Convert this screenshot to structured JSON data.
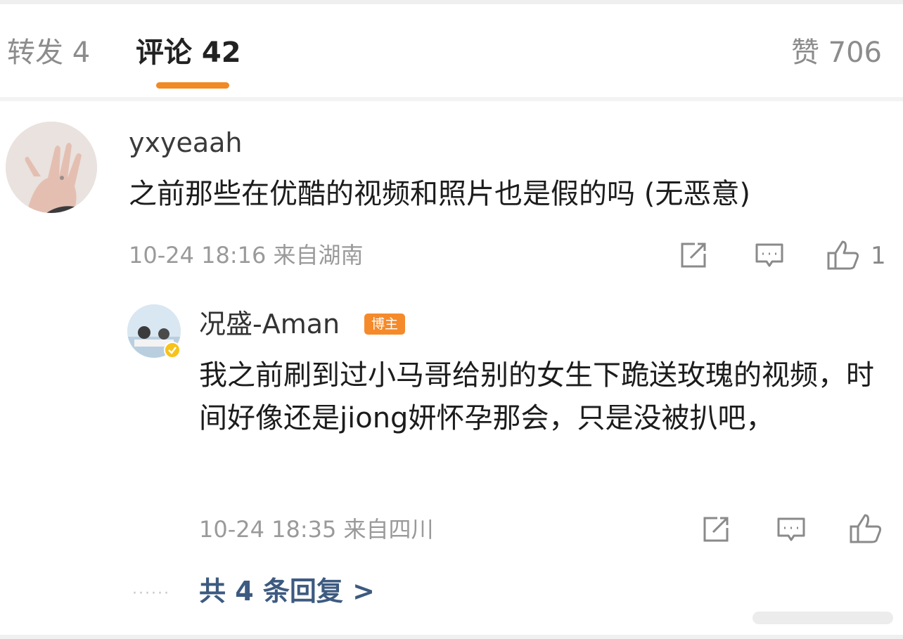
{
  "tabs": {
    "repost": "转发 4",
    "comment": "评论 42",
    "like": "赞 706"
  },
  "comment": {
    "username": "yxyeaah",
    "text": "之前那些在优酷的视频和照片也是假的吗 (无恶意)",
    "time": "10-24 18:16",
    "location": "来自湖南",
    "like_count": "1"
  },
  "reply": {
    "username": "况盛-Aman",
    "badge": "博主",
    "text": "我之前刷到过小马哥给别的女生下跪送玫瑰的视频，时间好像还是jiong妍怀孕那会，只是没被扒吧，",
    "time": "10-24 18:35",
    "location": "来自四川"
  },
  "more_replies": "共 4 条回复 >",
  "colors": {
    "accent": "#f08a24",
    "link": "#3d5a80",
    "badge": "#f58a2a"
  },
  "icons": [
    "share-icon",
    "comment-icon",
    "like-icon",
    "verified-icon"
  ]
}
